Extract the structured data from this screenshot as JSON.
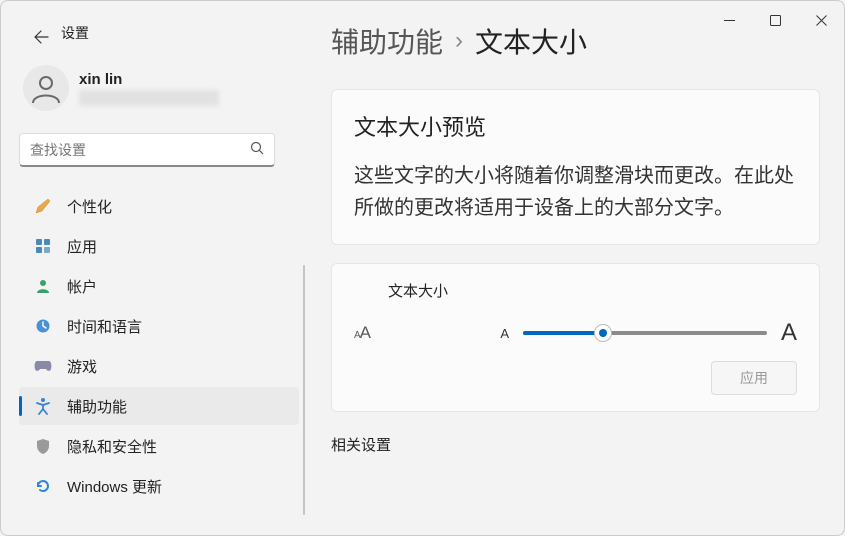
{
  "window": {
    "title": "设置"
  },
  "user": {
    "name": "xin lin"
  },
  "search": {
    "placeholder": "查找设置"
  },
  "nav": {
    "items": [
      {
        "icon": "paintbrush",
        "label": "个性化",
        "color": "#c88a2a"
      },
      {
        "icon": "apps",
        "label": "应用",
        "color": "#3878a8"
      },
      {
        "icon": "account",
        "label": "帐户",
        "color": "#36a36a"
      },
      {
        "icon": "time",
        "label": "时间和语言",
        "color": "#3878c8"
      },
      {
        "icon": "gaming",
        "label": "游戏",
        "color": "#6a6a8a"
      },
      {
        "icon": "accessibility",
        "label": "辅助功能",
        "color": "#3a82d4",
        "selected": true
      },
      {
        "icon": "privacy",
        "label": "隐私和安全性",
        "color": "#8a8a8a"
      },
      {
        "icon": "update",
        "label": "Windows 更新",
        "color": "#2a86d8"
      }
    ]
  },
  "breadcrumb": {
    "parent": "辅助功能",
    "current": "文本大小"
  },
  "preview": {
    "title": "文本大小预览",
    "text": "这些文字的大小将随着你调整滑块而更改。在此处所做的更改将适用于设备上的大部分文字。"
  },
  "slider": {
    "label": "文本大小",
    "small": "A",
    "large": "A",
    "apply": "应用"
  },
  "related": {
    "title": "相关设置"
  }
}
